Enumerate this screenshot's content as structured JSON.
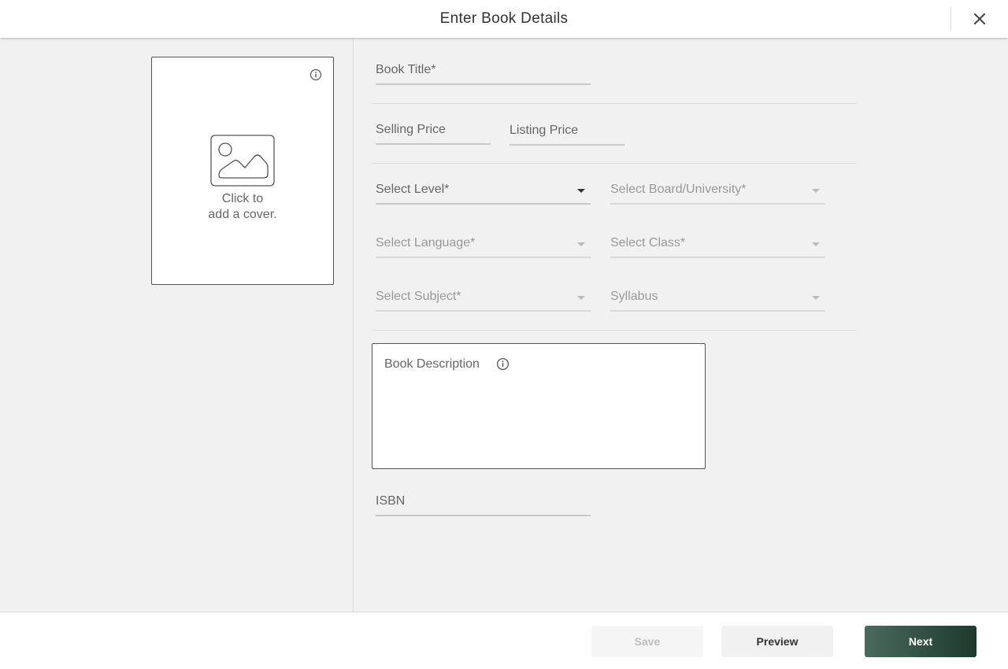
{
  "header": {
    "title": "Enter Book Details",
    "close_icon": "close-icon"
  },
  "cover": {
    "text_line1": "Click to",
    "text_line2": "add a cover.",
    "info_icon": "info-icon",
    "image_icon": "image-placeholder-icon"
  },
  "form": {
    "book_title": "Book Title*",
    "selling_price": "Selling Price",
    "listing_price": "Listing Price",
    "level": "Select Level*",
    "board": "Select Board/University*",
    "language": "Select Language*",
    "class": "Select Class*",
    "subject": "Select Subject*",
    "syllabus": "Syllabus",
    "description": "Book Description",
    "isbn": "ISBN"
  },
  "footer": {
    "save": "Save",
    "preview": "Preview",
    "next": "Next"
  },
  "colors": {
    "next_button_start": "#4a6a5d",
    "next_button_end": "#1d3a2d",
    "background": "#f1f1f1"
  }
}
